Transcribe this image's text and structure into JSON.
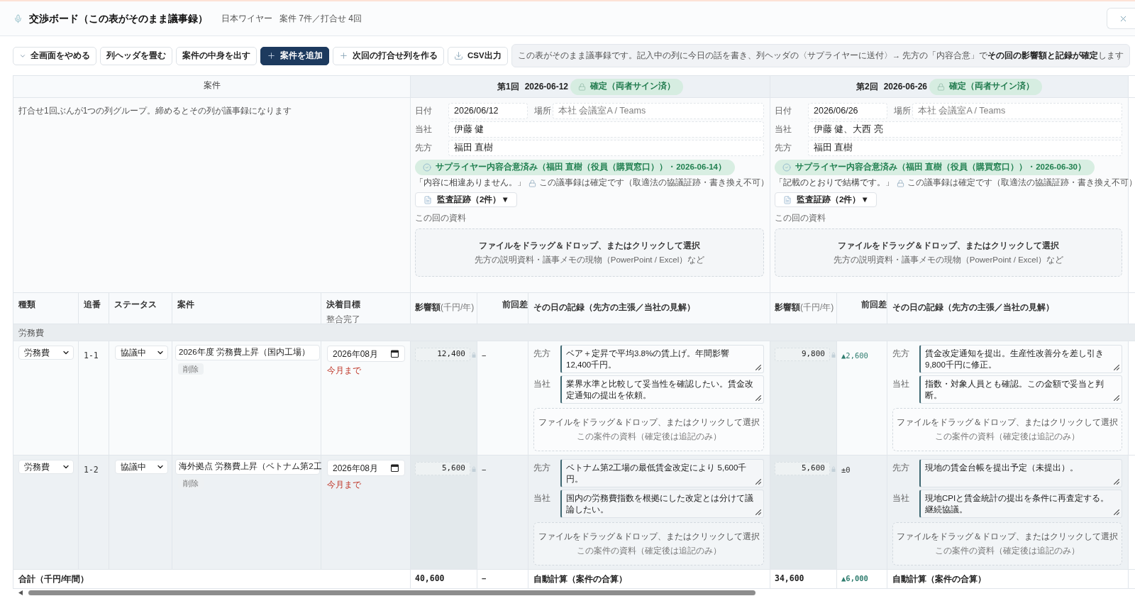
{
  "header": {
    "title": "交渉ボード（この表がそのまま議事録）",
    "supplier": "日本ワイヤー",
    "summary": "案件 7件／打合せ 4回"
  },
  "toolbar": {
    "buttons": [
      {
        "label": "全画面をやめる",
        "kind": "collapse",
        "primary": false
      },
      {
        "label": "列ヘッダを畳む",
        "kind": "plain",
        "primary": false
      },
      {
        "label": "案件の中身を出す",
        "kind": "plain",
        "primary": false
      },
      {
        "label": "案件を追加",
        "kind": "add",
        "primary": true
      },
      {
        "label": "次回の打合せ列を作る",
        "kind": "add",
        "primary": false
      },
      {
        "label": "CSV出力",
        "kind": "export",
        "primary": false
      }
    ],
    "notice": "この表がそのまま議事録です。記入中の列に今日の話を書き、列ヘッダの〈サプライヤーに送付〉→ 先方の「内容合意」で **その回の影響額と記録が確定**します"
  },
  "table": {
    "case_header": "案件",
    "case_note": "打合せ1回ぶんが1つの列グループ。締めるとその列が議事録になります",
    "columns": [
      {
        "label": "種類"
      },
      {
        "label": "追番"
      },
      {
        "label": "ステータス"
      },
      {
        "label": "案件"
      },
      {
        "label": "決着目標",
        "sublabel": "整合完了"
      }
    ],
    "meetings": [
      {
        "round": "第1回",
        "date": "2026-06-12",
        "status": {
          "label": "確定（両者サイン済）",
          "kind": "confirmed"
        },
        "field_rows": [
          [
            {
              "label": "日付",
              "value": "2026/06/12"
            },
            {
              "label": "場所",
              "placeholder": "本社 会議室A / Teams"
            }
          ],
          [
            {
              "label": "当社",
              "value": "伊藤 健"
            }
          ],
          [
            {
              "label": "先方",
              "value": "福田 直樹"
            }
          ]
        ],
        "agreement": {
          "label": "サプライヤー内容合意済み（福田 直樹（役員（購買窓口））・2026-06-14）",
          "quote": "「内容に相違ありません。」"
        },
        "lock_note": "この議事録は確定です（取適法の協議証跡・書き換え不可）",
        "audit_button": "監査証跡（2件）▼",
        "materials_label": "この回の資料",
        "dropzone": {
          "title": "ファイルをドラッグ＆ドロップ、またはクリックして選択",
          "hint": "先方の説明資料・議事メモの現物（PowerPoint / Excel）など"
        },
        "column_labels": {
          "impact": "**影響額**(千円/年)",
          "diff": "前回差",
          "record": "その日の記録（先方の主張／当社の見解）"
        },
        "total": {
          "impact": "40,600",
          "diff": {
            "text": "−",
            "kind": "none"
          },
          "record": "自動計算（案件の合算）"
        }
      },
      {
        "round": "第2回",
        "date": "2026-06-26",
        "status": {
          "label": "確定（両者サイン済）",
          "kind": "confirmed"
        },
        "field_rows": [
          [
            {
              "label": "日付",
              "value": "2026/06/26"
            },
            {
              "label": "場所",
              "placeholder": "本社 会議室A / Teams"
            }
          ],
          [
            {
              "label": "当社",
              "value": "伊藤 健、大西 亮"
            }
          ],
          [
            {
              "label": "先方",
              "value": "福田 直樹"
            }
          ]
        ],
        "agreement": {
          "label": "サプライヤー内容合意済み（福田 直樹（役員（購買窓口））・2026-06-30）",
          "quote": "「記載のとおりで結構です。」"
        },
        "lock_note": "この議事録は確定です（取適法の協議証跡・書き換え不可）",
        "audit_button": "監査証跡（2件）▼",
        "materials_label": "この回の資料",
        "dropzone": {
          "title": "ファイルをドラッグ＆ドロップ、またはクリックして選択",
          "hint": "先方の説明資料・議事メモの現物（PowerPoint / Excel）など"
        },
        "column_labels": {
          "impact": "**影響額**(千円/年)",
          "diff": "前回差",
          "record": "その日の記録（先方の主張／当社の見解）"
        },
        "total": {
          "impact": "34,600",
          "diff": {
            "text": "▲6,000",
            "kind": "up"
          },
          "record": "自動計算（案件の合算）"
        }
      }
    ],
    "groups": [
      {
        "name": "労務費",
        "rows": [
          {
            "category": "労務費",
            "number": "1-1",
            "status": "協議中",
            "title": "2026年度 労務費上昇（国内工場）",
            "delete_label": "削除",
            "target": "2026年08月",
            "target_note": "今月まで",
            "meetings": [
              {
                "impact": "12,400",
                "diff": {
                  "text": "−",
                  "kind": "none"
                },
                "entries": [
                  {
                    "speaker": "先方",
                    "text": "ベア＋定昇で平均3.8%の賃上げ。年間影響 12,400千円。"
                  },
                  {
                    "speaker": "当社",
                    "text": "業界水準と比較して妥当性を確認したい。賃金改定通知の提出を依頼。"
                  }
                ],
                "dropzone": {
                  "title": "ファイルをドラッグ＆ドロップ、またはクリックして選択",
                  "hint": "この案件の資料（確定後は追記のみ）"
                }
              },
              {
                "impact": "9,800",
                "diff": {
                  "text": "▲2,600",
                  "kind": "up"
                },
                "entries": [
                  {
                    "speaker": "先方",
                    "text": "賃金改定通知を提出。生産性改善分を差し引き 9,800千円に修正。"
                  },
                  {
                    "speaker": "当社",
                    "text": "指数・対象人員とも確認。この金額で妥当と判断。"
                  }
                ],
                "dropzone": {
                  "title": "ファイルをドラッグ＆ドロップ、またはクリックして選択",
                  "hint": "この案件の資料（確定後は追記のみ）"
                }
              }
            ]
          },
          {
            "category": "労務費",
            "number": "1-2",
            "status": "協議中",
            "title": "海外拠点 労務費上昇（ベトナム第2工",
            "delete_label": "削除",
            "target": "2026年08月",
            "target_note": "今月まで",
            "meetings": [
              {
                "impact": "5,600",
                "diff": {
                  "text": "−",
                  "kind": "none"
                },
                "entries": [
                  {
                    "speaker": "先方",
                    "text": "ベトナム第2工場の最低賃金改定により 5,600千円。"
                  },
                  {
                    "speaker": "当社",
                    "text": "国内の労務費指数を根拠にした改定とは分けて議論したい。"
                  }
                ],
                "dropzone": {
                  "title": "ファイルをドラッグ＆ドロップ、またはクリックして選択",
                  "hint": "この案件の資料（確定後は追記のみ）"
                }
              },
              {
                "impact": "5,600",
                "diff": {
                  "text": "±0",
                  "kind": "even"
                },
                "entries": [
                  {
                    "speaker": "先方",
                    "text": "現地の賃金台帳を提出予定（未提出）。"
                  },
                  {
                    "speaker": "当社",
                    "text": "現地CPIと賃金統計の提出を条件に再査定する。継続協議。"
                  }
                ],
                "dropzone": {
                  "title": "ファイルをドラッグ＆ドロップ、またはクリックして選択",
                  "hint": "この案件の資料（確定後は追記のみ）"
                }
              }
            ]
          }
        ]
      }
    ],
    "total_label": "合計（千円/年間）"
  }
}
